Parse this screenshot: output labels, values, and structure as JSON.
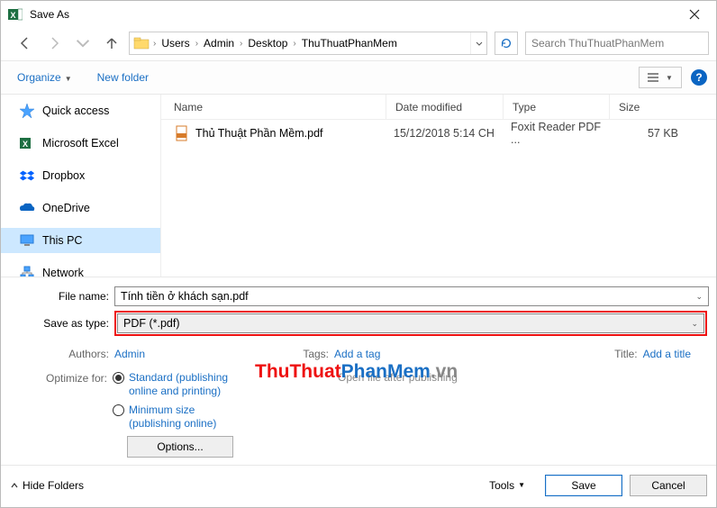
{
  "title": "Save As",
  "nav": {
    "path": [
      "Users",
      "Admin",
      "Desktop",
      "ThuThuatPhanMem"
    ],
    "search_placeholder": "Search ThuThuatPhanMem"
  },
  "toolbar": {
    "organize": "Organize",
    "new_folder": "New folder"
  },
  "sidebar": [
    {
      "icon": "star",
      "label": "Quick access"
    },
    {
      "icon": "excel",
      "label": "Microsoft Excel"
    },
    {
      "icon": "dropbox",
      "label": "Dropbox"
    },
    {
      "icon": "onedrive",
      "label": "OneDrive"
    },
    {
      "icon": "pc",
      "label": "This PC",
      "selected": true
    },
    {
      "icon": "network",
      "label": "Network"
    }
  ],
  "columns": {
    "name": "Name",
    "date": "Date modified",
    "type": "Type",
    "size": "Size"
  },
  "files": [
    {
      "name": "Thủ Thuật Phần Mềm.pdf",
      "date": "15/12/2018 5:14 CH",
      "type": "Foxit Reader PDF ...",
      "size": "57 KB"
    }
  ],
  "form": {
    "file_name_label": "File name:",
    "file_name": "Tính tiền ở khách sạn.pdf",
    "save_type_label": "Save as type:",
    "save_type": "PDF (*.pdf)",
    "authors_label": "Authors:",
    "authors": "Admin",
    "tags_label": "Tags:",
    "tags": "Add a tag",
    "title_label": "Title:",
    "title": "Add a title",
    "optimize_label": "Optimize for:",
    "opt1": "Standard (publishing online and printing)",
    "opt2": "Minimum size (publishing online)",
    "options_btn": "Options...",
    "open_after": "Open file after publishing"
  },
  "footer": {
    "hide_folders": "Hide Folders",
    "tools": "Tools",
    "save": "Save",
    "cancel": "Cancel"
  },
  "watermark": {
    "a": "ThuThuat",
    "b": "PhanMem",
    "c": ".vn"
  }
}
